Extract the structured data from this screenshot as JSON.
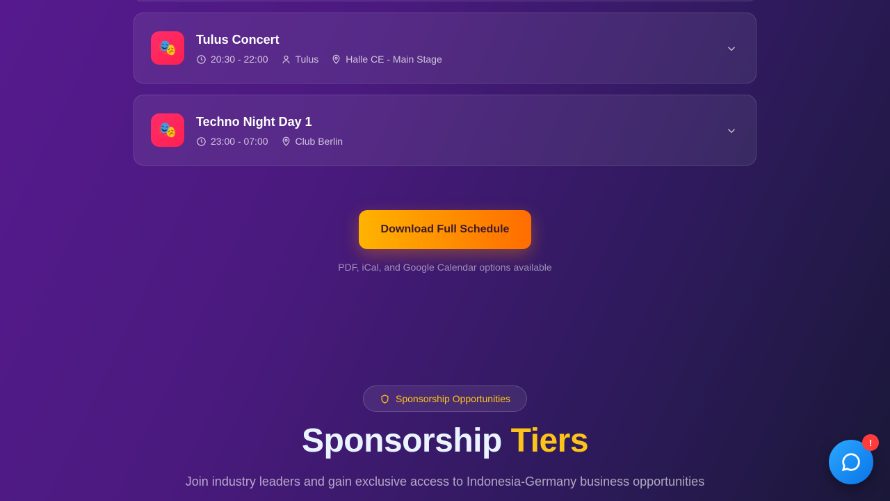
{
  "events": [
    {
      "title": "Tulus Concert",
      "time": "20:30 - 22:00",
      "performer": "Tulus",
      "location": "Halle CE - Main Stage",
      "icon": "theater-masks-icon"
    },
    {
      "title": "Techno Night Day 1",
      "time": "23:00 - 07:00",
      "location": "Club Berlin",
      "icon": "theater-masks-icon"
    }
  ],
  "download": {
    "label": "Download Full Schedule",
    "note": "PDF, iCal, and Google Calendar options available"
  },
  "sponsorship": {
    "badge": "Sponsorship Opportunities",
    "headline_part1": "Sponsorship",
    "headline_part2": "Tiers",
    "subtitle": "Join industry leaders and gain exclusive access to Indonesia-Germany business opportunities"
  },
  "chat": {
    "badge": "!",
    "icon": "chat-bubble-icon"
  },
  "colors": {
    "accent_orange": "#ff8c00",
    "accent_yellow": "#fcc419",
    "event_icon_bg": "#ff2d6a",
    "chat_blue": "#1a8cff",
    "alert_red": "#ff3b3b"
  }
}
